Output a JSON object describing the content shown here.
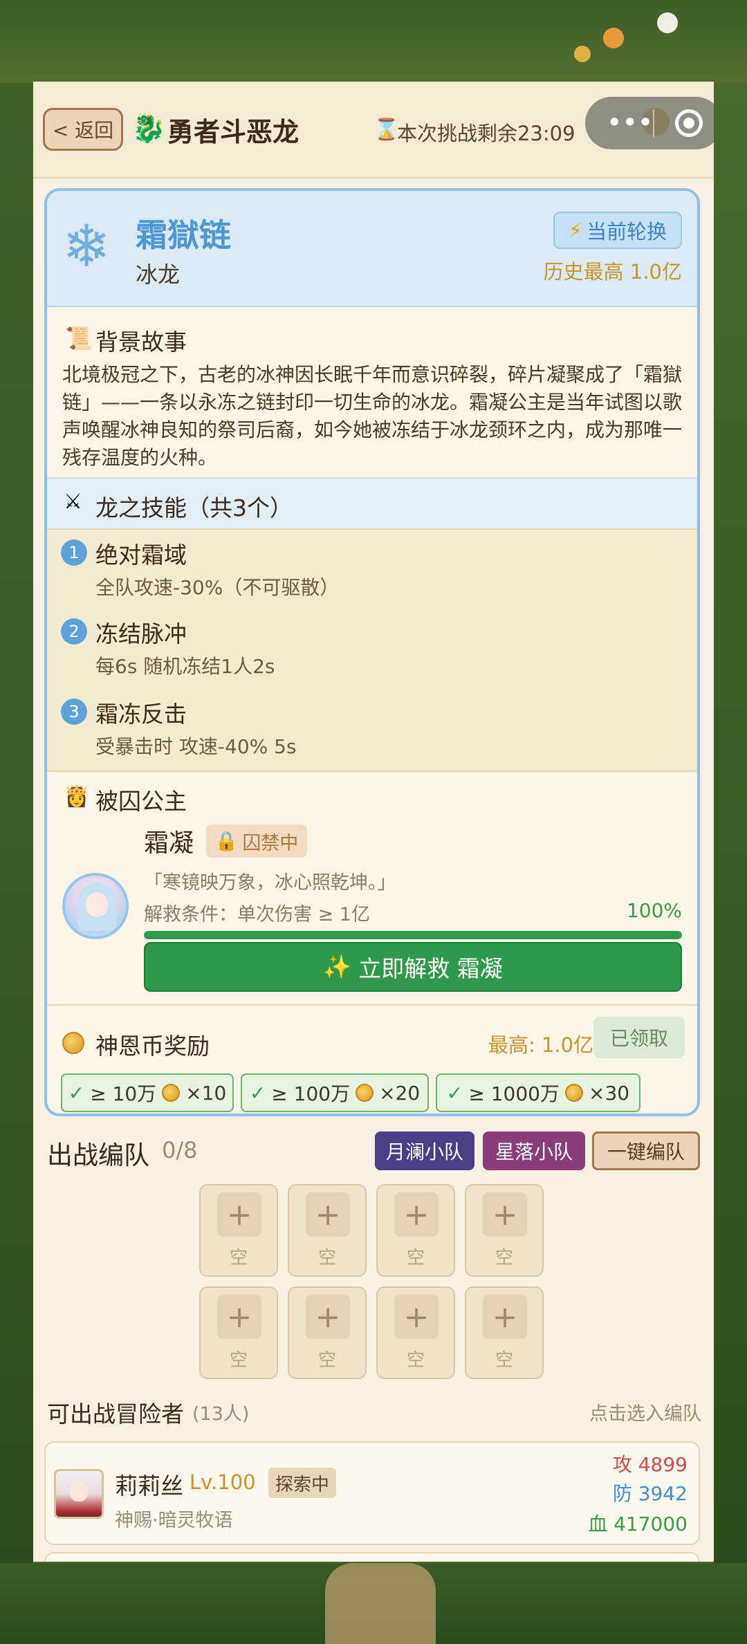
{
  "header": {
    "back_label": "< 返回",
    "title": "勇者斗恶龙",
    "countdown": "本次挑战剩余23:09",
    "capsule_dots": "•••"
  },
  "dragon": {
    "name": "霜獄链",
    "type": "冰龙",
    "rotation_badge": "当前轮换",
    "history_best": "历史最高 1.0亿",
    "story_title": "背景故事",
    "story": "北境极冠之下，古老的冰神因长眠千年而意识碎裂，碎片凝聚成了「霜獄链」——一条以永冻之链封印一切生命的冰龙。霜凝公主是当年试图以歌声唤醒冰神良知的祭司后裔，如今她被冻结于冰龙颈环之内，成为那唯一残存温度的火种。",
    "skills_title": "龙之技能（共3个）",
    "skills": [
      {
        "num": "1",
        "name": "绝对霜域",
        "desc": "全队攻速-30%（不可驱散）"
      },
      {
        "num": "2",
        "name": "冻结脉冲",
        "desc": "每6s 随机冻结1人2s"
      },
      {
        "num": "3",
        "name": "霜冻反击",
        "desc": "受暴击时 攻速-40% 5s"
      }
    ]
  },
  "princess": {
    "section_title": "被囚公主",
    "name": "霜凝",
    "status": "囚禁中",
    "quote": "「寒镜映万象，冰心照乾坤。」",
    "rescue_condition": "解救条件：单次伤害 ≥ 1亿",
    "progress_label": "100%",
    "progress": 1.0,
    "rescue_button": "立即解救 霜凝"
  },
  "reward": {
    "title": "神恩币奖励",
    "max": "最高: 1.0亿",
    "claimed": "已领取",
    "tiers": [
      {
        "threshold": "≥ 10万",
        "amount": "×10"
      },
      {
        "threshold": "≥ 100万",
        "amount": "×20"
      },
      {
        "threshold": "≥ 1000万",
        "amount": "×30"
      }
    ]
  },
  "team": {
    "title": "出战编队",
    "count": "0/8",
    "squad1": "月澜小队",
    "squad2": "星落小队",
    "auto_button": "一键编队",
    "slot_plus": "+",
    "slot_label": "空"
  },
  "available": {
    "title": "可出战冒险者",
    "count": "(13人)",
    "hint": "点击选入编队",
    "adventurers": [
      {
        "name": "莉莉丝",
        "level": "Lv.100",
        "status": "探索中",
        "title": "神赐·暗灵牧语",
        "atk": "攻 4899",
        "def": "防 3942",
        "hp": "血 417000"
      }
    ]
  },
  "colors": {
    "accent_blue": "#4d98d3",
    "green": "#2f9a4a",
    "gold": "#c9942e",
    "squad1": "#4b3f8a",
    "squad2": "#8a3d78"
  }
}
